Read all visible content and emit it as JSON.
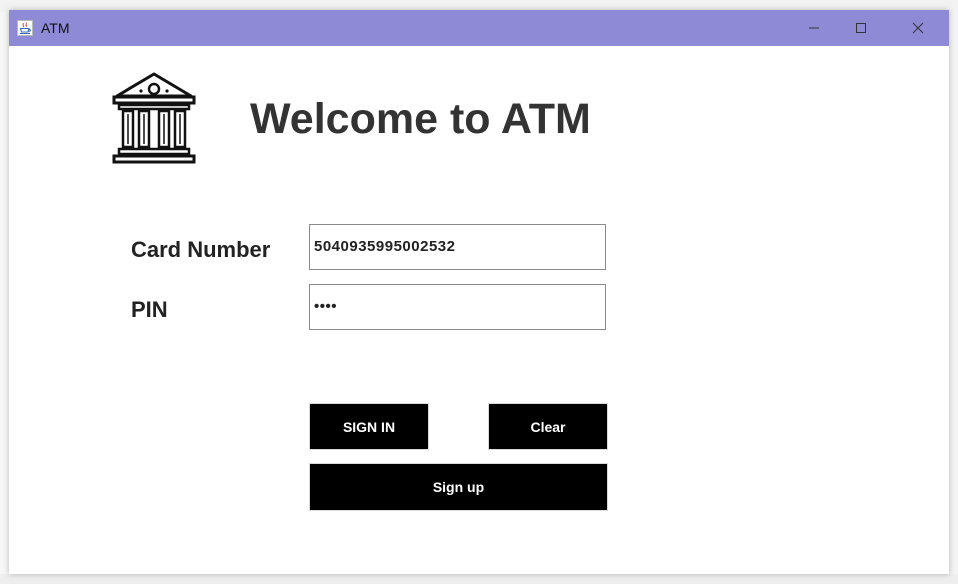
{
  "window": {
    "title": "ATM"
  },
  "header": {
    "title": "Welcome to ATM",
    "logo_icon": "bank-building-icon"
  },
  "form": {
    "card_number_label": "Card Number",
    "card_number_value": "5040935995002532",
    "pin_label": "PIN",
    "pin_value": "••••"
  },
  "buttons": {
    "sign_in": "SIGN IN",
    "clear": "Clear",
    "sign_up": "Sign up"
  },
  "colors": {
    "titlebar": "#8f8ad6",
    "button_bg": "#000000",
    "button_text": "#ffffff",
    "heading_text": "#333333"
  }
}
